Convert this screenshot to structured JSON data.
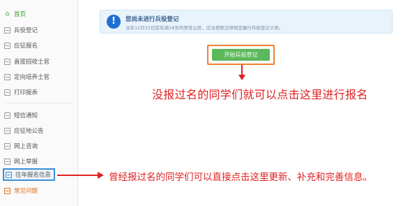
{
  "sidebar": {
    "items": [
      {
        "label": "首页"
      },
      {
        "label": "兵役登记"
      },
      {
        "label": "应征报名"
      },
      {
        "label": "直接招收士官"
      },
      {
        "label": "定向培养士官"
      },
      {
        "label": "打印报表"
      },
      {
        "label": "短信通知"
      },
      {
        "label": "应征地公告"
      },
      {
        "label": "网上咨询"
      },
      {
        "label": "网上举报"
      },
      {
        "label": "往年报名信息"
      },
      {
        "label": "常见问题"
      }
    ]
  },
  "notice": {
    "icon": "!",
    "title": "您尚未进行兵役登记",
    "description": "当年12月31日前年满18岁的男性公民，应当按照法律规定履行兵役登记义务。"
  },
  "main": {
    "start_button_label": "开始兵役登记"
  },
  "annotations": {
    "register_hint": "没报过名的同学们就可以点击这里进行报名",
    "history_hint": "曾经报过名的同学们可以直接点击这里更新、补充和完善信息。"
  },
  "colors": {
    "accent_green": "#5cb85c",
    "annotation_red": "#e02020",
    "highlight_orange": "#f08030",
    "highlight_blue": "#3b8fd6"
  }
}
